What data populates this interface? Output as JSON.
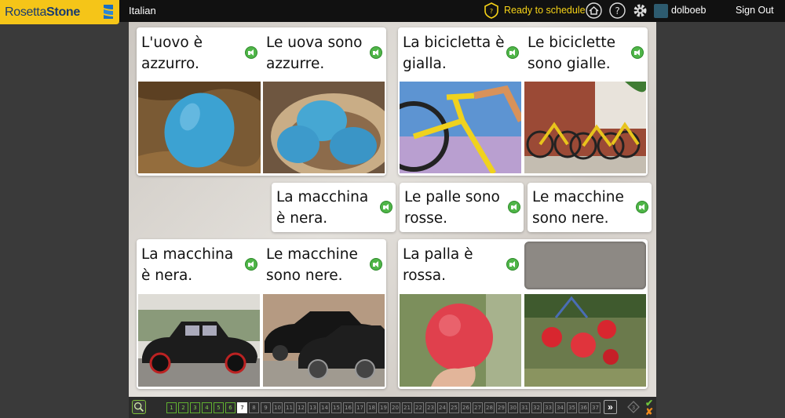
{
  "header": {
    "logo_text_1": "Rosetta",
    "logo_text_2": "Stone",
    "language": "Italian",
    "schedule_label": "Ready to schedule",
    "username": "dolboeb",
    "signout_label": "Sign Out"
  },
  "exercise": {
    "pairs": [
      {
        "left_text": "L'uovo è azzurro.",
        "right_text": "Le uova sono azzurre.",
        "left_image": "blue-egg-image",
        "right_image": "blue-eggs-image"
      },
      {
        "left_text": "La bicicletta è gialla.",
        "right_text": "Le biciclette sono gialle.",
        "left_image": "yellow-bicycle-image",
        "right_image": "yellow-bicycles-image"
      },
      {
        "left_text": "La macchina è nera.",
        "right_text": "Le macchine sono nere.",
        "left_image": "black-car-image",
        "right_image": "black-cars-image"
      },
      {
        "left_text": "La palla è rossa.",
        "right_text": "",
        "left_image": "red-ball-image",
        "right_image": "red-balls-image"
      }
    ],
    "choices": [
      "La macchina è nera.",
      "Le palle sono rosse.",
      "Le macchine sono nere."
    ]
  },
  "navigation": {
    "pages": [
      "1",
      "2",
      "3",
      "4",
      "5",
      "6",
      "7",
      "8",
      "9",
      "10",
      "11",
      "12",
      "13",
      "14",
      "15",
      "16",
      "17",
      "18",
      "19",
      "20",
      "21",
      "22",
      "23",
      "24",
      "25",
      "26",
      "27",
      "28",
      "29",
      "30",
      "31",
      "32",
      "33",
      "34",
      "35",
      "36",
      "37"
    ],
    "completed_count": 6,
    "current_page": "7",
    "next_label": "»",
    "score_label": "3"
  },
  "colors": {
    "accent_yellow": "#f7d417",
    "logo_bg": "#f5c518",
    "speaker_green": "#4fb548"
  }
}
